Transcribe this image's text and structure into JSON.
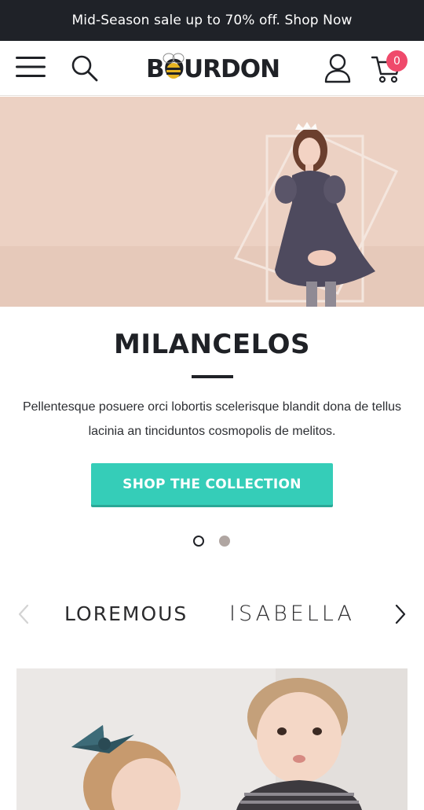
{
  "announcement": {
    "text": "Mid-Season sale up to 70% off. Shop Now"
  },
  "header": {
    "logo_text": "BOURDON",
    "cart_count": "0"
  },
  "hero": {
    "title": "MILANCELOS",
    "description": "Pellentesque posuere orci lobortis scelerisque blandit dona de tellus lacinia an tinciduntos cosmopolis de melitos.",
    "cta_label": "SHOP THE COLLECTION",
    "slide_count": 2,
    "active_slide": 1
  },
  "brands": [
    "LOREMOUS",
    "ISABELLA"
  ],
  "colors": {
    "announcement_bg": "#1f2228",
    "hero_bg": "#ecd1c3",
    "cta_bg": "#35cdb8",
    "badge_bg": "#ef4a6b",
    "text_dark": "#1f2126"
  }
}
